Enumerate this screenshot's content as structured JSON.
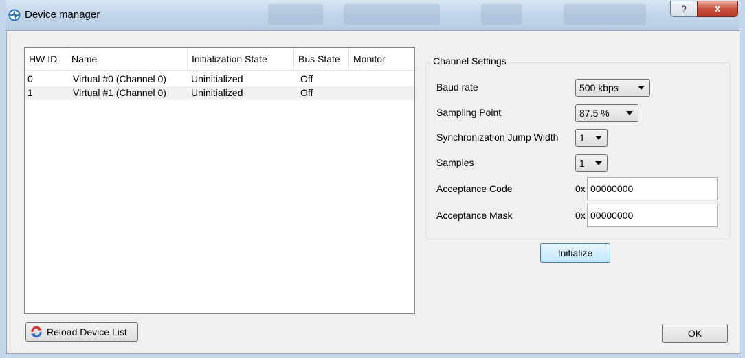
{
  "window": {
    "title": "Device manager",
    "help_glyph": "?",
    "close_glyph": "x"
  },
  "table": {
    "headers": [
      "HW ID",
      "Name",
      "Initialization State",
      "Bus State",
      "Monitor"
    ],
    "rows": [
      {
        "hwid": "0",
        "name": "Virtual #0 (Channel 0)",
        "init_state": "Uninitialized",
        "bus_state": "Off",
        "monitor": ""
      },
      {
        "hwid": "1",
        "name": "Virtual #1 (Channel 0)",
        "init_state": "Uninitialized",
        "bus_state": "Off",
        "monitor": ""
      }
    ]
  },
  "channel_settings": {
    "title": "Channel Settings",
    "baud_rate": {
      "label": "Baud rate",
      "value": "500 kbps"
    },
    "sampling_point": {
      "label": "Sampling Point",
      "value": "87.5 %"
    },
    "sjw": {
      "label": "Synchronization Jump Width",
      "value": "1"
    },
    "samples": {
      "label": "Samples",
      "value": "1"
    },
    "acceptance_code": {
      "label": "Acceptance Code",
      "prefix": "0x",
      "value": "00000000"
    },
    "acceptance_mask": {
      "label": "Acceptance Mask",
      "prefix": "0x",
      "value": "00000000"
    }
  },
  "buttons": {
    "initialize": "Initialize",
    "reload": "Reload Device List",
    "ok": "OK"
  },
  "icons": {
    "app": "connection-icon",
    "reload": "refresh-icon"
  },
  "colors": {
    "titlebar": "#c3d6ea",
    "close_button": "#c75240",
    "client_bg": "#f0f0f0",
    "default_button": "#bee6fd"
  }
}
